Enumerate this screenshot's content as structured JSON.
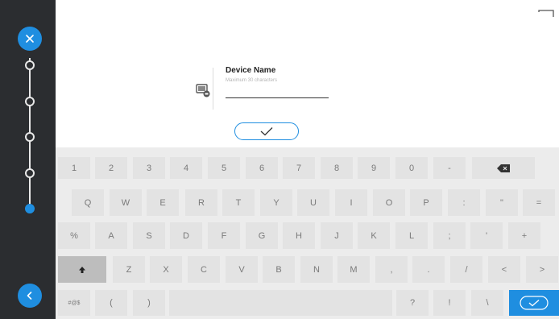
{
  "sidebar": {
    "close_icon": "close-icon",
    "back_icon": "chevron-left-icon",
    "steps": [
      "step-1",
      "step-2",
      "step-3",
      "step-4",
      "step-5"
    ],
    "active_step": 5,
    "accent": "#1f8ee0"
  },
  "form": {
    "label": "Device Name",
    "hint": "Maximum 30 characters",
    "value": "",
    "icon": "device-icon"
  },
  "confirm_icon": "checkmark-icon",
  "keyboard": {
    "row1": [
      "1",
      "2",
      "3",
      "4",
      "5",
      "6",
      "7",
      "8",
      "9",
      "0",
      "-"
    ],
    "row2": [
      "Q",
      "W",
      "E",
      "R",
      "T",
      "Y",
      "U",
      "I",
      "O",
      "P",
      ":",
      "\"",
      "="
    ],
    "row3": [
      "%",
      "A",
      "S",
      "D",
      "F",
      "G",
      "H",
      "J",
      "K",
      "L",
      ";",
      "'",
      "+"
    ],
    "row4": [
      "Z",
      "X",
      "C",
      "V",
      "B",
      "N",
      "M",
      ",",
      ".",
      "/",
      "<",
      ">"
    ],
    "row5": [
      "#@$",
      "(",
      ")",
      "?",
      "!",
      "\\"
    ],
    "backspace_icon": "backspace-icon",
    "shift_icon": "shift-icon",
    "enter_icon": "checkmark-icon"
  }
}
